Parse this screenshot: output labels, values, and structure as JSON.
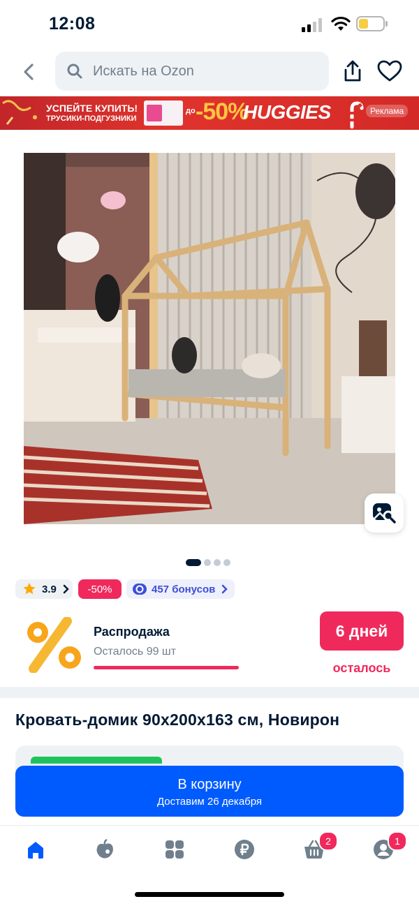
{
  "status_bar": {
    "time": "12:08"
  },
  "search": {
    "placeholder": "Искать на Ozon"
  },
  "banner": {
    "line1": "УСПЕЙТЕ КУПИТЬ!",
    "line2": "ТРУСИКИ-ПОДГУЗНИКИ",
    "upto": "до",
    "discount": "-50%",
    "brand": "HUGGIES",
    "ad_label": "Реклама"
  },
  "gallery": {
    "total_images": 4,
    "active_index": 0
  },
  "chips": {
    "rating": "3.9",
    "discount": "-50%",
    "bonus": "457 бонусов"
  },
  "sale": {
    "title": "Распродажа",
    "remaining": "Осталось 99 шт",
    "progress": 1.0,
    "days": "6 дней",
    "days_caption": "осталось"
  },
  "product": {
    "title": "Кровать-домик 90x200x163 см, Новирон"
  },
  "cart_button": {
    "label": "В корзину",
    "sublabel": "Доставим 26 декабря"
  },
  "tabbar": {
    "items": [
      {
        "name": "home",
        "icon": "home-icon",
        "active": true
      },
      {
        "name": "fresh",
        "icon": "fresh-icon"
      },
      {
        "name": "catalog",
        "icon": "catalog-icon"
      },
      {
        "name": "finance",
        "icon": "ruble-icon"
      },
      {
        "name": "cart",
        "icon": "basket-icon",
        "badge": "2"
      },
      {
        "name": "profile",
        "icon": "profile-icon",
        "badge": "1"
      }
    ]
  },
  "colors": {
    "accent": "#005bff",
    "sale": "#f0295c",
    "text": "#001a34"
  }
}
